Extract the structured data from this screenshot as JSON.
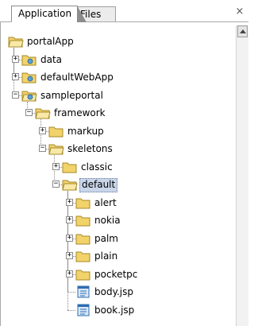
{
  "tabs": [
    {
      "label": "Application",
      "active": true
    },
    {
      "label": "Files",
      "active": false
    }
  ],
  "close_glyph": "×",
  "tree": {
    "selected": "default",
    "nodes": [
      {
        "label": "portalApp",
        "icon": "open-folder-icon",
        "depth": 0,
        "toggle": ""
      },
      {
        "label": "data",
        "icon": "web-folder-icon",
        "depth": 1,
        "toggle": "+"
      },
      {
        "label": "defaultWebApp",
        "icon": "web-folder-icon",
        "depth": 1,
        "toggle": "+"
      },
      {
        "label": "sampleportal",
        "icon": "web-folder-open-icon",
        "depth": 1,
        "toggle": "−"
      },
      {
        "label": "framework",
        "icon": "open-folder-icon",
        "depth": 2,
        "toggle": "−"
      },
      {
        "label": "markup",
        "icon": "folder-icon",
        "depth": 3,
        "toggle": "+"
      },
      {
        "label": "skeletons",
        "icon": "open-folder-icon",
        "depth": 3,
        "toggle": "−"
      },
      {
        "label": "classic",
        "icon": "folder-icon",
        "depth": 4,
        "toggle": "+"
      },
      {
        "label": "default",
        "icon": "open-folder-icon",
        "depth": 4,
        "toggle": "−"
      },
      {
        "label": "alert",
        "icon": "folder-icon",
        "depth": 5,
        "toggle": "+"
      },
      {
        "label": "nokia",
        "icon": "folder-icon",
        "depth": 5,
        "toggle": "+"
      },
      {
        "label": "palm",
        "icon": "folder-icon",
        "depth": 5,
        "toggle": "+"
      },
      {
        "label": "plain",
        "icon": "folder-icon",
        "depth": 5,
        "toggle": "+"
      },
      {
        "label": "pocketpc",
        "icon": "folder-icon",
        "depth": 5,
        "toggle": "+"
      },
      {
        "label": "body.jsp",
        "icon": "jsp-file-icon",
        "depth": 5,
        "toggle": ""
      },
      {
        "label": "book.jsp",
        "icon": "jsp-file-icon",
        "depth": 5,
        "toggle": ""
      }
    ]
  },
  "colors": {
    "folder": "#f2d36a",
    "folder_dark": "#a78a2a",
    "web_folder": "#5aa0d8",
    "selection": "#c9d6ea",
    "file": "#d9e8f7"
  }
}
